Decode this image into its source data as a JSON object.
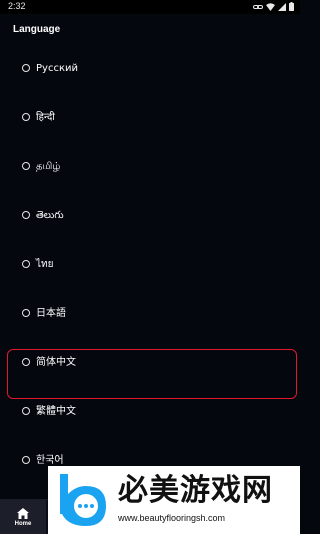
{
  "status_bar": {
    "time": "2:32"
  },
  "section_title": "Language",
  "languages": [
    {
      "label": "Русский"
    },
    {
      "label": "हिन्दी"
    },
    {
      "label": "தமிழ்"
    },
    {
      "label": "తెలుగు"
    },
    {
      "label": "ไทย"
    },
    {
      "label": "日本語"
    },
    {
      "label": "简体中文"
    },
    {
      "label": "繁體中文"
    },
    {
      "label": "한국어"
    }
  ],
  "highlight_color": "#e0192a",
  "bottom_nav": {
    "home_label": "Home"
  },
  "watermark": {
    "title": "必美游戏网",
    "url": "www.beautyflooringsh.com"
  }
}
